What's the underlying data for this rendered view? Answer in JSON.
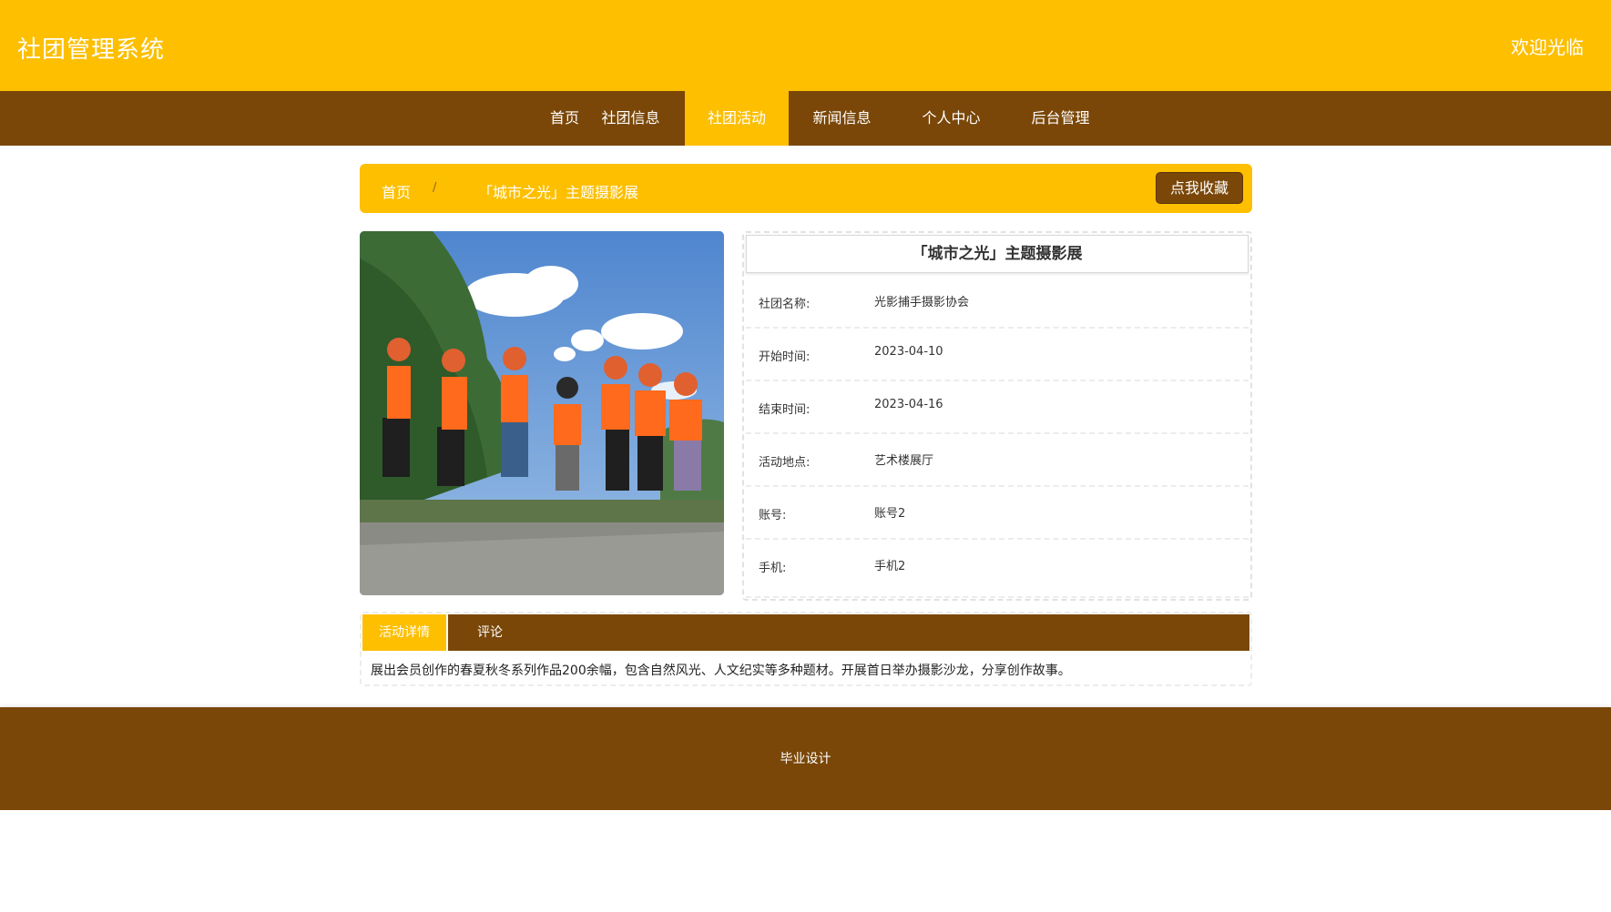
{
  "header": {
    "title": "社团管理系统",
    "welcome": "欢迎光临"
  },
  "nav": {
    "items": [
      {
        "label": "首页"
      },
      {
        "label": "社团信息"
      },
      {
        "label": "社团活动"
      },
      {
        "label": "新闻信息"
      },
      {
        "label": "个人中心"
      },
      {
        "label": "后台管理"
      }
    ],
    "active": "社团活动"
  },
  "breadcrumb": {
    "home": "首页",
    "separator": "/",
    "current": "「城市之光」主题摄影展"
  },
  "favorite_button": "点我收藏",
  "activity": {
    "title": "「城市之光」主题摄影展",
    "fields": [
      {
        "label": "社团名称:",
        "value": "光影捕手摄影协会"
      },
      {
        "label": "开始时间:",
        "value": "2023-04-10"
      },
      {
        "label": "结束时间:",
        "value": "2023-04-16"
      },
      {
        "label": "活动地点:",
        "value": "艺术楼展厅"
      },
      {
        "label": "账号:",
        "value": "账号2"
      },
      {
        "label": "手机:",
        "value": "手机2"
      }
    ]
  },
  "tabs": {
    "items": [
      {
        "label": "活动详情"
      },
      {
        "label": "评论"
      }
    ],
    "active": "活动详情",
    "content": "展出会员创作的春夏秋冬系列作品200余幅，包含自然风光、人文纪实等多种题材。开展首日举办摄影沙龙，分享创作故事。"
  },
  "footer": {
    "text": "毕业设计"
  },
  "colors": {
    "primary_yellow": "#fdbf00",
    "primary_brown": "#7a4708"
  }
}
